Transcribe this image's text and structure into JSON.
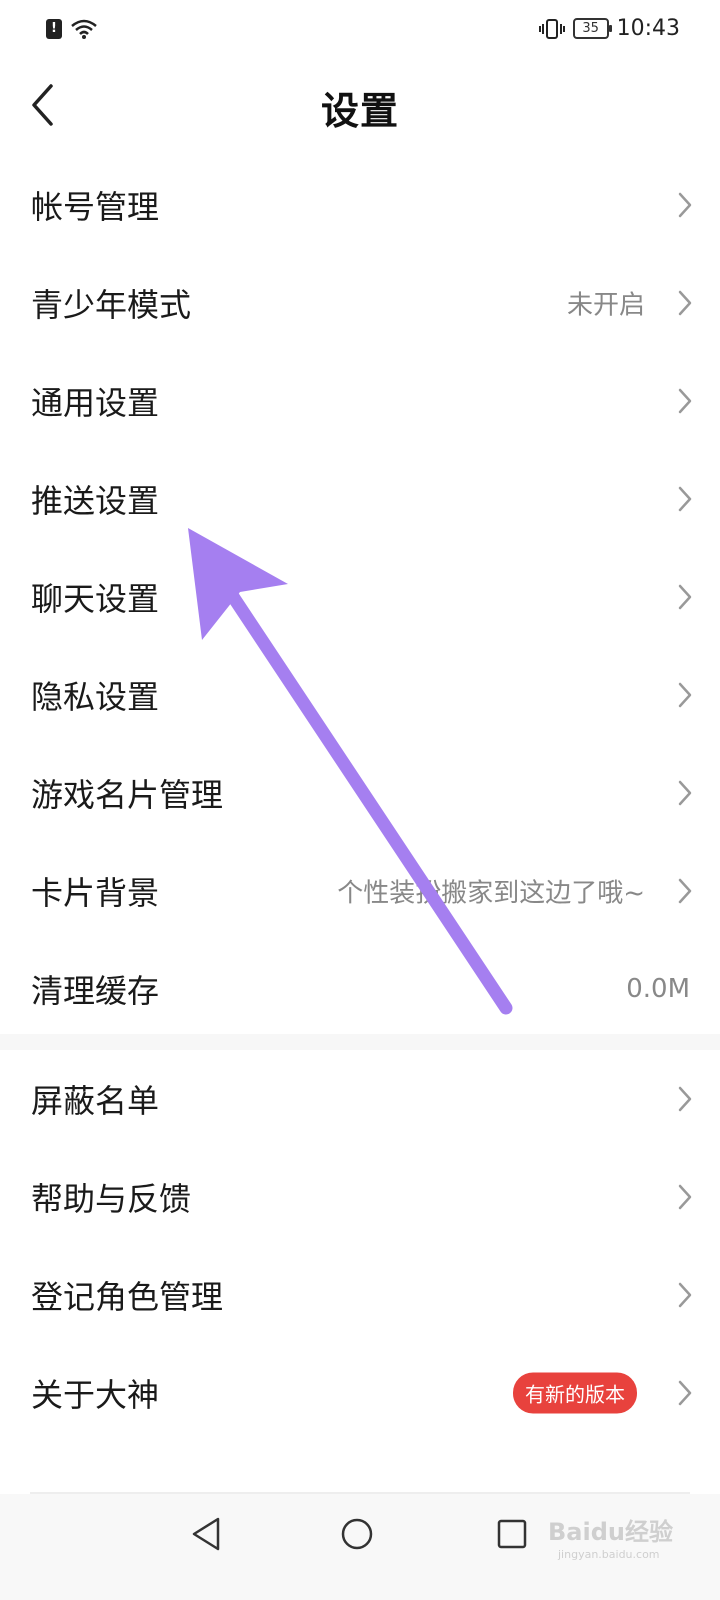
{
  "status_bar": {
    "sim_alert": "!",
    "battery": "35",
    "time": "10:43"
  },
  "header": {
    "back_icon": "chevron-left-icon",
    "title": "设置"
  },
  "group1": [
    {
      "label": "帐号管理",
      "value": "",
      "chevron": true
    },
    {
      "label": "青少年模式",
      "value": "未开启",
      "chevron": true
    },
    {
      "label": "通用设置",
      "value": "",
      "chevron": true
    },
    {
      "label": "推送设置",
      "value": "",
      "chevron": true
    },
    {
      "label": "聊天设置",
      "value": "",
      "chevron": true
    },
    {
      "label": "隐私设置",
      "value": "",
      "chevron": true
    },
    {
      "label": "游戏名片管理",
      "value": "",
      "chevron": true
    },
    {
      "label": "卡片背景",
      "value": "个性装扮搬家到这边了哦~",
      "chevron": true
    },
    {
      "label": "清理缓存",
      "value": "0.0M",
      "chevron": false
    }
  ],
  "group2": [
    {
      "label": "屏蔽名单",
      "chevron": true
    },
    {
      "label": "帮助与反馈",
      "chevron": true
    },
    {
      "label": "登记角色管理",
      "chevron": true
    },
    {
      "label": "关于大神",
      "badge": "有新的版本",
      "chevron": true
    }
  ],
  "nav_bar": {
    "back_icon": "triangle-back-icon",
    "home_icon": "circle-home-icon",
    "recent_icon": "square-recent-icon"
  },
  "watermark": {
    "text": "Baidu经验",
    "sub": "jingyan.baidu.com"
  },
  "colors": {
    "arrow": "#a57ff0",
    "badge": "#e8423d",
    "value_text": "#888888"
  }
}
